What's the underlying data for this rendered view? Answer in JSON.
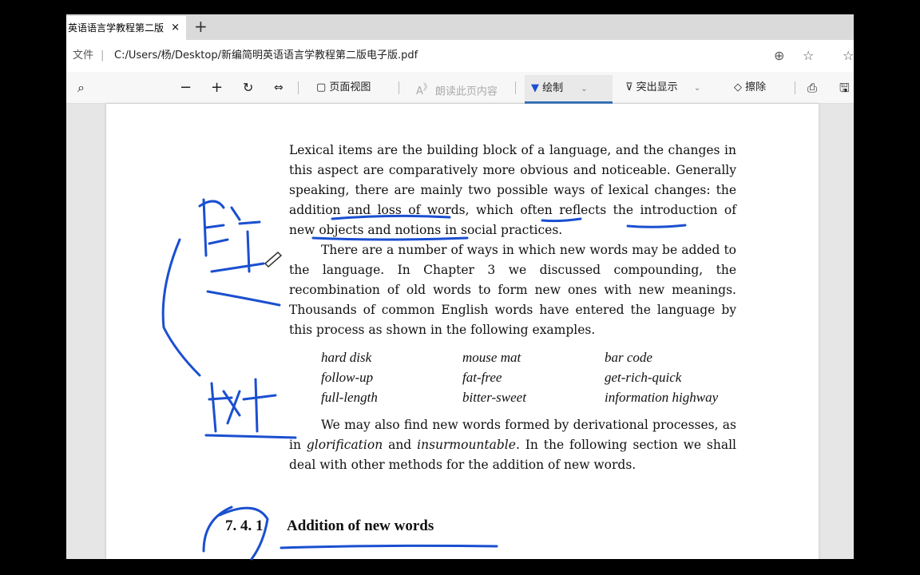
{
  "tab": {
    "title": "英语语言学教程第二版",
    "close": "×",
    "new_tab": "+"
  },
  "address": {
    "label": "文件",
    "url": "C:/Users/杨/Desktop/新编简明英语语言学教程第二版电子版.pdf"
  },
  "toolbar": {
    "page_view": "页面视图",
    "read_aloud": "朗读此页内容",
    "draw": "绘制",
    "highlight": "突出显示",
    "erase": "擦除"
  },
  "ink_color": "#1a4fd0",
  "document": {
    "paragraphs": [
      "Lexical items are the building block of a language, and the changes in this aspect are comparatively more obvious and noticeable. Generally speaking, there are mainly two possible ways of lexical changes: the addition and loss of words, which often reflects the introduction of new objects and notions in social practices.",
      "There are a number of ways in which new words may be added to the language. In Chapter 3 we discussed compounding, the recombination of old words to form new ones with new meanings. Thousands of common English words have entered the language by this process as shown in the following examples."
    ],
    "examples": [
      [
        "hard disk",
        "mouse mat",
        "bar code"
      ],
      [
        "follow-up",
        "fat-free",
        "get-rich-quick"
      ],
      [
        "full-length",
        "bitter-sweet",
        "information highway"
      ]
    ],
    "para3": {
      "a": "We may also find new words formed by derivational processes, as in ",
      "b": "glorification",
      "c": " and ",
      "d": "insurmountable",
      "e": ". In the following section we shall deal with other methods for the addition of new words."
    },
    "section_number": "7. 4. 1",
    "section_title": "Addition of new words"
  }
}
